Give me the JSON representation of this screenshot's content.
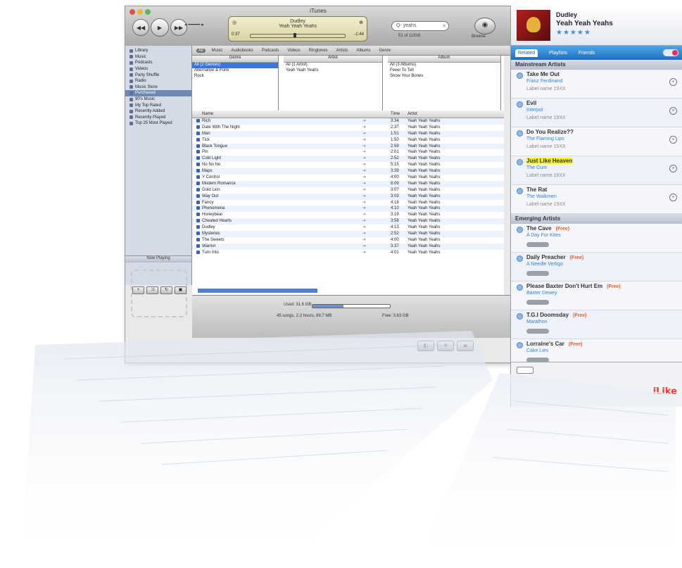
{
  "itunes": {
    "title": "iTunes",
    "lcd": {
      "line1": "Dudley",
      "line2": "Yeah Yeah Yeahs",
      "elapsed": "0:37",
      "remaining": "-1:44"
    },
    "search": {
      "value": "Q- yeahs"
    },
    "search_label": "51 of 11918",
    "browse_label": "Browse",
    "filters": [
      "All",
      "Music",
      "Audiobooks",
      "Podcasts",
      "Videos",
      "Ringtones",
      "Artists",
      "Albums",
      "Genre"
    ],
    "sidebar": [
      "Library",
      "Music",
      "Podcasts",
      "Videos",
      "Party Shuffle",
      "Radio",
      "Music Store",
      "Purchased",
      "90's Music",
      "My Top Rated",
      "Recently Added",
      "Recently Played",
      "Top 25 Most Played"
    ],
    "artwork_header": "Now Playing",
    "artwork_placeholder": "Drop Album Artwork Here",
    "browser": {
      "genres_header": "Genre",
      "genres": [
        "All (2 Genres)",
        "Alternative & Punk",
        "Rock"
      ],
      "artists_header": "Artist",
      "artists": [
        "All (1 Artist)",
        "Yeah Yeah Yeahs"
      ],
      "albums_header": "Album",
      "albums": [
        "All (3 Albums)",
        "Fever To Tell",
        "Show Your Bones"
      ]
    },
    "tracks_header": {
      "name": "Name",
      "time": "Time",
      "artist": "Artist"
    },
    "tracks": [
      {
        "name": "Rich",
        "time": "3:34",
        "artist": "Yeah Yeah Yeahs"
      },
      {
        "name": "Date With The Night",
        "time": "2:37",
        "artist": "Yeah Yeah Yeahs"
      },
      {
        "name": "Man",
        "time": "1:51",
        "artist": "Yeah Yeah Yeahs"
      },
      {
        "name": "Tick",
        "time": "1:50",
        "artist": "Yeah Yeah Yeahs"
      },
      {
        "name": "Black Tongue",
        "time": "2:59",
        "artist": "Yeah Yeah Yeahs"
      },
      {
        "name": "Pin",
        "time": "2:01",
        "artist": "Yeah Yeah Yeahs"
      },
      {
        "name": "Cold Light",
        "time": "2:52",
        "artist": "Yeah Yeah Yeahs"
      },
      {
        "name": "No No No",
        "time": "5:15",
        "artist": "Yeah Yeah Yeahs"
      },
      {
        "name": "Maps",
        "time": "3:39",
        "artist": "Yeah Yeah Yeahs"
      },
      {
        "name": "Y Control",
        "time": "4:00",
        "artist": "Yeah Yeah Yeahs"
      },
      {
        "name": "Modern Romance",
        "time": "6:09",
        "artist": "Yeah Yeah Yeahs"
      },
      {
        "name": "Gold Lion",
        "time": "3:07",
        "artist": "Yeah Yeah Yeahs"
      },
      {
        "name": "Way Out",
        "time": "3:03",
        "artist": "Yeah Yeah Yeahs"
      },
      {
        "name": "Fancy",
        "time": "4:18",
        "artist": "Yeah Yeah Yeahs"
      },
      {
        "name": "Phenomena",
        "time": "4:10",
        "artist": "Yeah Yeah Yeahs"
      },
      {
        "name": "Honeybear",
        "time": "3:19",
        "artist": "Yeah Yeah Yeahs"
      },
      {
        "name": "Cheated Hearts",
        "time": "3:58",
        "artist": "Yeah Yeah Yeahs"
      },
      {
        "name": "Dudley",
        "time": "4:13",
        "artist": "Yeah Yeah Yeahs"
      },
      {
        "name": "Mysteries",
        "time": "2:52",
        "artist": "Yeah Yeah Yeahs"
      },
      {
        "name": "The Sweets",
        "time": "4:00",
        "artist": "Yeah Yeah Yeahs"
      },
      {
        "name": "Warrior",
        "time": "3:37",
        "artist": "Yeah Yeah Yeahs"
      },
      {
        "name": "Turn Into",
        "time": "4:01",
        "artist": "Yeah Yeah Yeahs"
      }
    ],
    "status": {
      "summary": "Used: 31.6 GB",
      "count": "45 songs, 2.2 hours, 89.7 MB",
      "free": "Free: 3.63 GB",
      "progress": 0.4
    }
  },
  "like": {
    "now_playing": {
      "title": "Dudley",
      "artist": "Yeah Yeah Yeahs",
      "stars": "★★★★★"
    },
    "tabs": [
      "Related",
      "Playlists",
      "Friends"
    ],
    "mainstream_header": "Mainstream Artists",
    "mainstream": [
      {
        "track": "Take Me Out",
        "artist": "Franz Ferdinand",
        "label": "Label name 19XX"
      },
      {
        "track": "Evil",
        "artist": "Interpol",
        "label": "Label name 19XX"
      },
      {
        "track": "Do You Realize??",
        "artist": "The Flaming Lips",
        "label": "Label name 19XX"
      },
      {
        "track": "Just Like Heaven",
        "artist": "The Cure",
        "label": "Label name 19XX",
        "highlight": true
      },
      {
        "track": "The Rat",
        "artist": "The Walkmen",
        "label": "Label name 19XX"
      }
    ],
    "emerging_header": "Emerging Artists",
    "emerging": [
      {
        "track": "The Cave",
        "artist": "A Day For Kites",
        "free": "(Free)"
      },
      {
        "track": "Daily Preacher",
        "artist": "A Needle Vertigo",
        "free": "(Free)"
      },
      {
        "track": "Please Baxter Don't Hurt Em",
        "artist": "Baxter Dewey",
        "free": "(Free)"
      },
      {
        "track": "T.G.I Doomsday",
        "artist": "Marathon",
        "free": "(Free)"
      },
      {
        "track": "Lorraine's Car",
        "artist": "Cake Lies",
        "free": "(Free)"
      }
    ],
    "logo": "iLike"
  }
}
